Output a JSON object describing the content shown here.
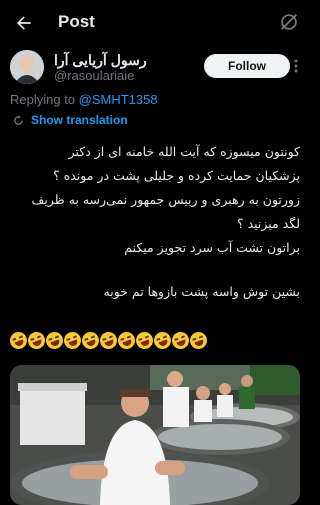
{
  "header": {
    "title": "Post"
  },
  "author": {
    "name": "رسول آریایی آرا",
    "handle": "@rasoulariaie"
  },
  "follow_label": "Follow",
  "replying": {
    "prefix": "Replying to ",
    "mention": "@SMHT1358"
  },
  "translation": {
    "label": "Show translation"
  },
  "tweet": {
    "lines": [
      "کونتون میسوزه که آیت الله خامنه ای از دکتر",
      "پزشکیان حمایت کرده و جلیلی پشت در مونده ؟",
      "زورتون به رهبری و رییس جمهور نمی‌رسه به ظریف",
      "لگد میزنید ؟",
      "براتون تشت آب سرد تجویز میکنم",
      "بشین توش واسه پشت بازوها تم خوبه"
    ],
    "emoji_count": 11
  },
  "colors": {
    "accent": "#1d9bf0",
    "background": "#000000",
    "text": "#e7e9ea",
    "muted": "#71767b"
  }
}
